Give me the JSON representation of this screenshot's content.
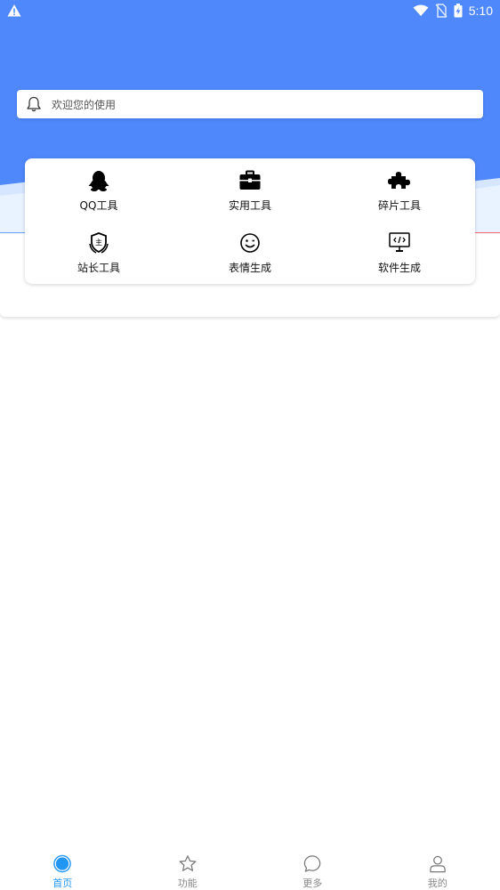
{
  "status_bar": {
    "time": "5:10",
    "icons": [
      "warning-icon",
      "wifi-icon",
      "no-sim-icon",
      "battery-charging-icon"
    ]
  },
  "notice": {
    "icon": "bell-icon",
    "text": "欢迎您的使用"
  },
  "tools": [
    {
      "label": "QQ工具",
      "icon": "qq-penguin-icon"
    },
    {
      "label": "实用工具",
      "icon": "toolbox-icon"
    },
    {
      "label": "碎片工具",
      "icon": "puzzle-icon"
    },
    {
      "label": "站长工具",
      "icon": "webmaster-badge-icon"
    },
    {
      "label": "表情生成",
      "icon": "smiley-icon"
    },
    {
      "label": "软件生成",
      "icon": "code-monitor-icon"
    }
  ],
  "bottom_nav": [
    {
      "label": "首页",
      "icon": "home-circle-icon",
      "active": true
    },
    {
      "label": "功能",
      "icon": "star-icon",
      "active": false
    },
    {
      "label": "更多",
      "icon": "chat-bubble-icon",
      "active": false
    },
    {
      "label": "我的",
      "icon": "user-icon",
      "active": false
    }
  ],
  "colors": {
    "header": "#4f88fb",
    "active": "#2196f3",
    "inactive": "#888888"
  }
}
